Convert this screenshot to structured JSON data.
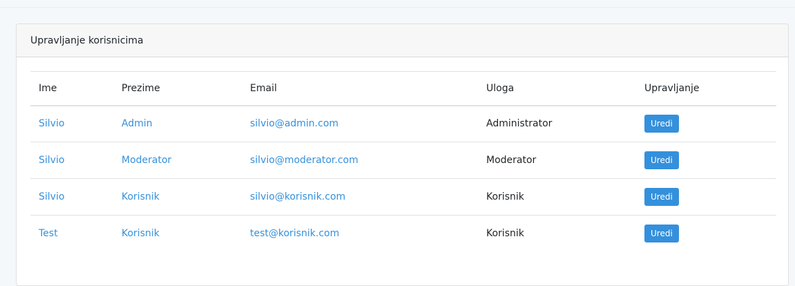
{
  "card": {
    "title": "Upravljanje korisnicima"
  },
  "table": {
    "headers": [
      "Ime",
      "Prezime",
      "Email",
      "Uloga",
      "Upravljanje"
    ],
    "rows": [
      {
        "ime": "Silvio",
        "prezime": "Admin",
        "email": "silvio@admin.com",
        "uloga": "Administrator",
        "action": "Uredi"
      },
      {
        "ime": "Silvio",
        "prezime": "Moderator",
        "email": "silvio@moderator.com",
        "uloga": "Moderator",
        "action": "Uredi"
      },
      {
        "ime": "Silvio",
        "prezime": "Korisnik",
        "email": "silvio@korisnik.com",
        "uloga": "Korisnik",
        "action": "Uredi"
      },
      {
        "ime": "Test",
        "prezime": "Korisnik",
        "email": "test@korisnik.com",
        "uloga": "Korisnik",
        "action": "Uredi"
      }
    ]
  },
  "colors": {
    "link": "#3490dc",
    "button": "#3490dc",
    "background": "#f5f8fa"
  }
}
